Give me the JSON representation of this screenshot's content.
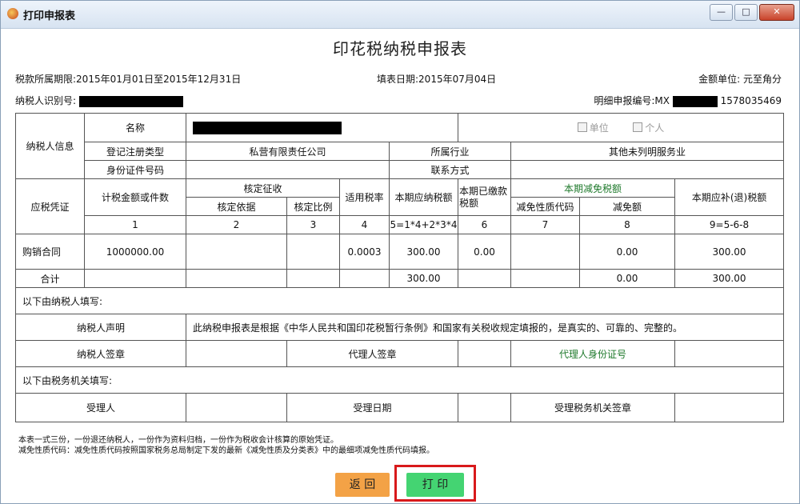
{
  "window": {
    "title": "打印申报表",
    "min_label": "—",
    "max_label": "□",
    "close_label": "✕"
  },
  "doc_title": "印花税纳税申报表",
  "meta": {
    "period_label": "税款所属期限:2015年01月01日至2015年12月31日",
    "fill_date_label": "填表日期:2015年07月04日",
    "unit_label": "金额单位: 元至角分",
    "taxpayer_id_label": "纳税人识别号:",
    "detail_no_label": "明细申报编号:MX",
    "detail_no_suffix": "1578035469"
  },
  "table": {
    "info_section": "纳税人信息",
    "name_label": "名称",
    "unit_check": "单位",
    "person_check": "个人",
    "reg_type_label": "登记注册类型",
    "reg_type_value": "私营有限责任公司",
    "industry_label": "所属行业",
    "industry_value": "其他未列明服务业",
    "id_type_label": "身份证件号码",
    "contact_label": "联系方式",
    "voucher_label": "应税凭证",
    "amount_label": "计税金额或件数",
    "approve_label": "核定征收",
    "approve_basis": "核定依据",
    "approve_ratio": "核定比例",
    "rate_label": "适用税率",
    "payable_label": "本期应纳税额",
    "paid_label": "本期已缴税额",
    "paid_label_1": "本期已缴款",
    "paid_label_2": "税额",
    "reduce_label": "本期减免税额",
    "reduce_code": "减免性质代码",
    "reduce_amount": "减免额",
    "refund_label": "本期应补(退)税额",
    "col_nums": [
      "1",
      "2",
      "3",
      "4",
      "5=1*4+2*3*4",
      "6",
      "7",
      "8",
      "9=5-6-8"
    ],
    "row1": {
      "name": "购销合同",
      "amount": "1000000.00",
      "basis": "",
      "ratio": "",
      "rate": "0.0003",
      "payable": "300.00",
      "paid": "0.00",
      "code": "",
      "reduce": "0.00",
      "refund": "300.00"
    },
    "total": {
      "name": "合计",
      "payable": "300.00",
      "reduce": "0.00",
      "refund": "300.00"
    },
    "taxpayer_fill": "以下由纳税人填写:",
    "declare_label": "纳税人声明",
    "declare_text": "此纳税申报表是根据《中华人民共和国印花税暂行条例》和国家有关税收规定填报的，是真实的、可靠的、完整的。",
    "sign_label": "纳税人签章",
    "agent_sign_label": "代理人签章",
    "agent_id_label": "代理人身份证号",
    "tax_office_fill": "以下由税务机关填写:",
    "receiver_label": "受理人",
    "receive_date_label": "受理日期",
    "office_sign_label": "受理税务机关签章"
  },
  "notes": {
    "line1": "本表一式三份，一份退还纳税人，一份作为资料归档，一份作为税收会计核算的原始凭证。",
    "line2": "减免性质代码：减免性质代码按照国家税务总局制定下发的最新《减免性质及分类表》中的最细项减免性质代码填报。"
  },
  "buttons": {
    "back": "返 回",
    "print": "打 印"
  }
}
